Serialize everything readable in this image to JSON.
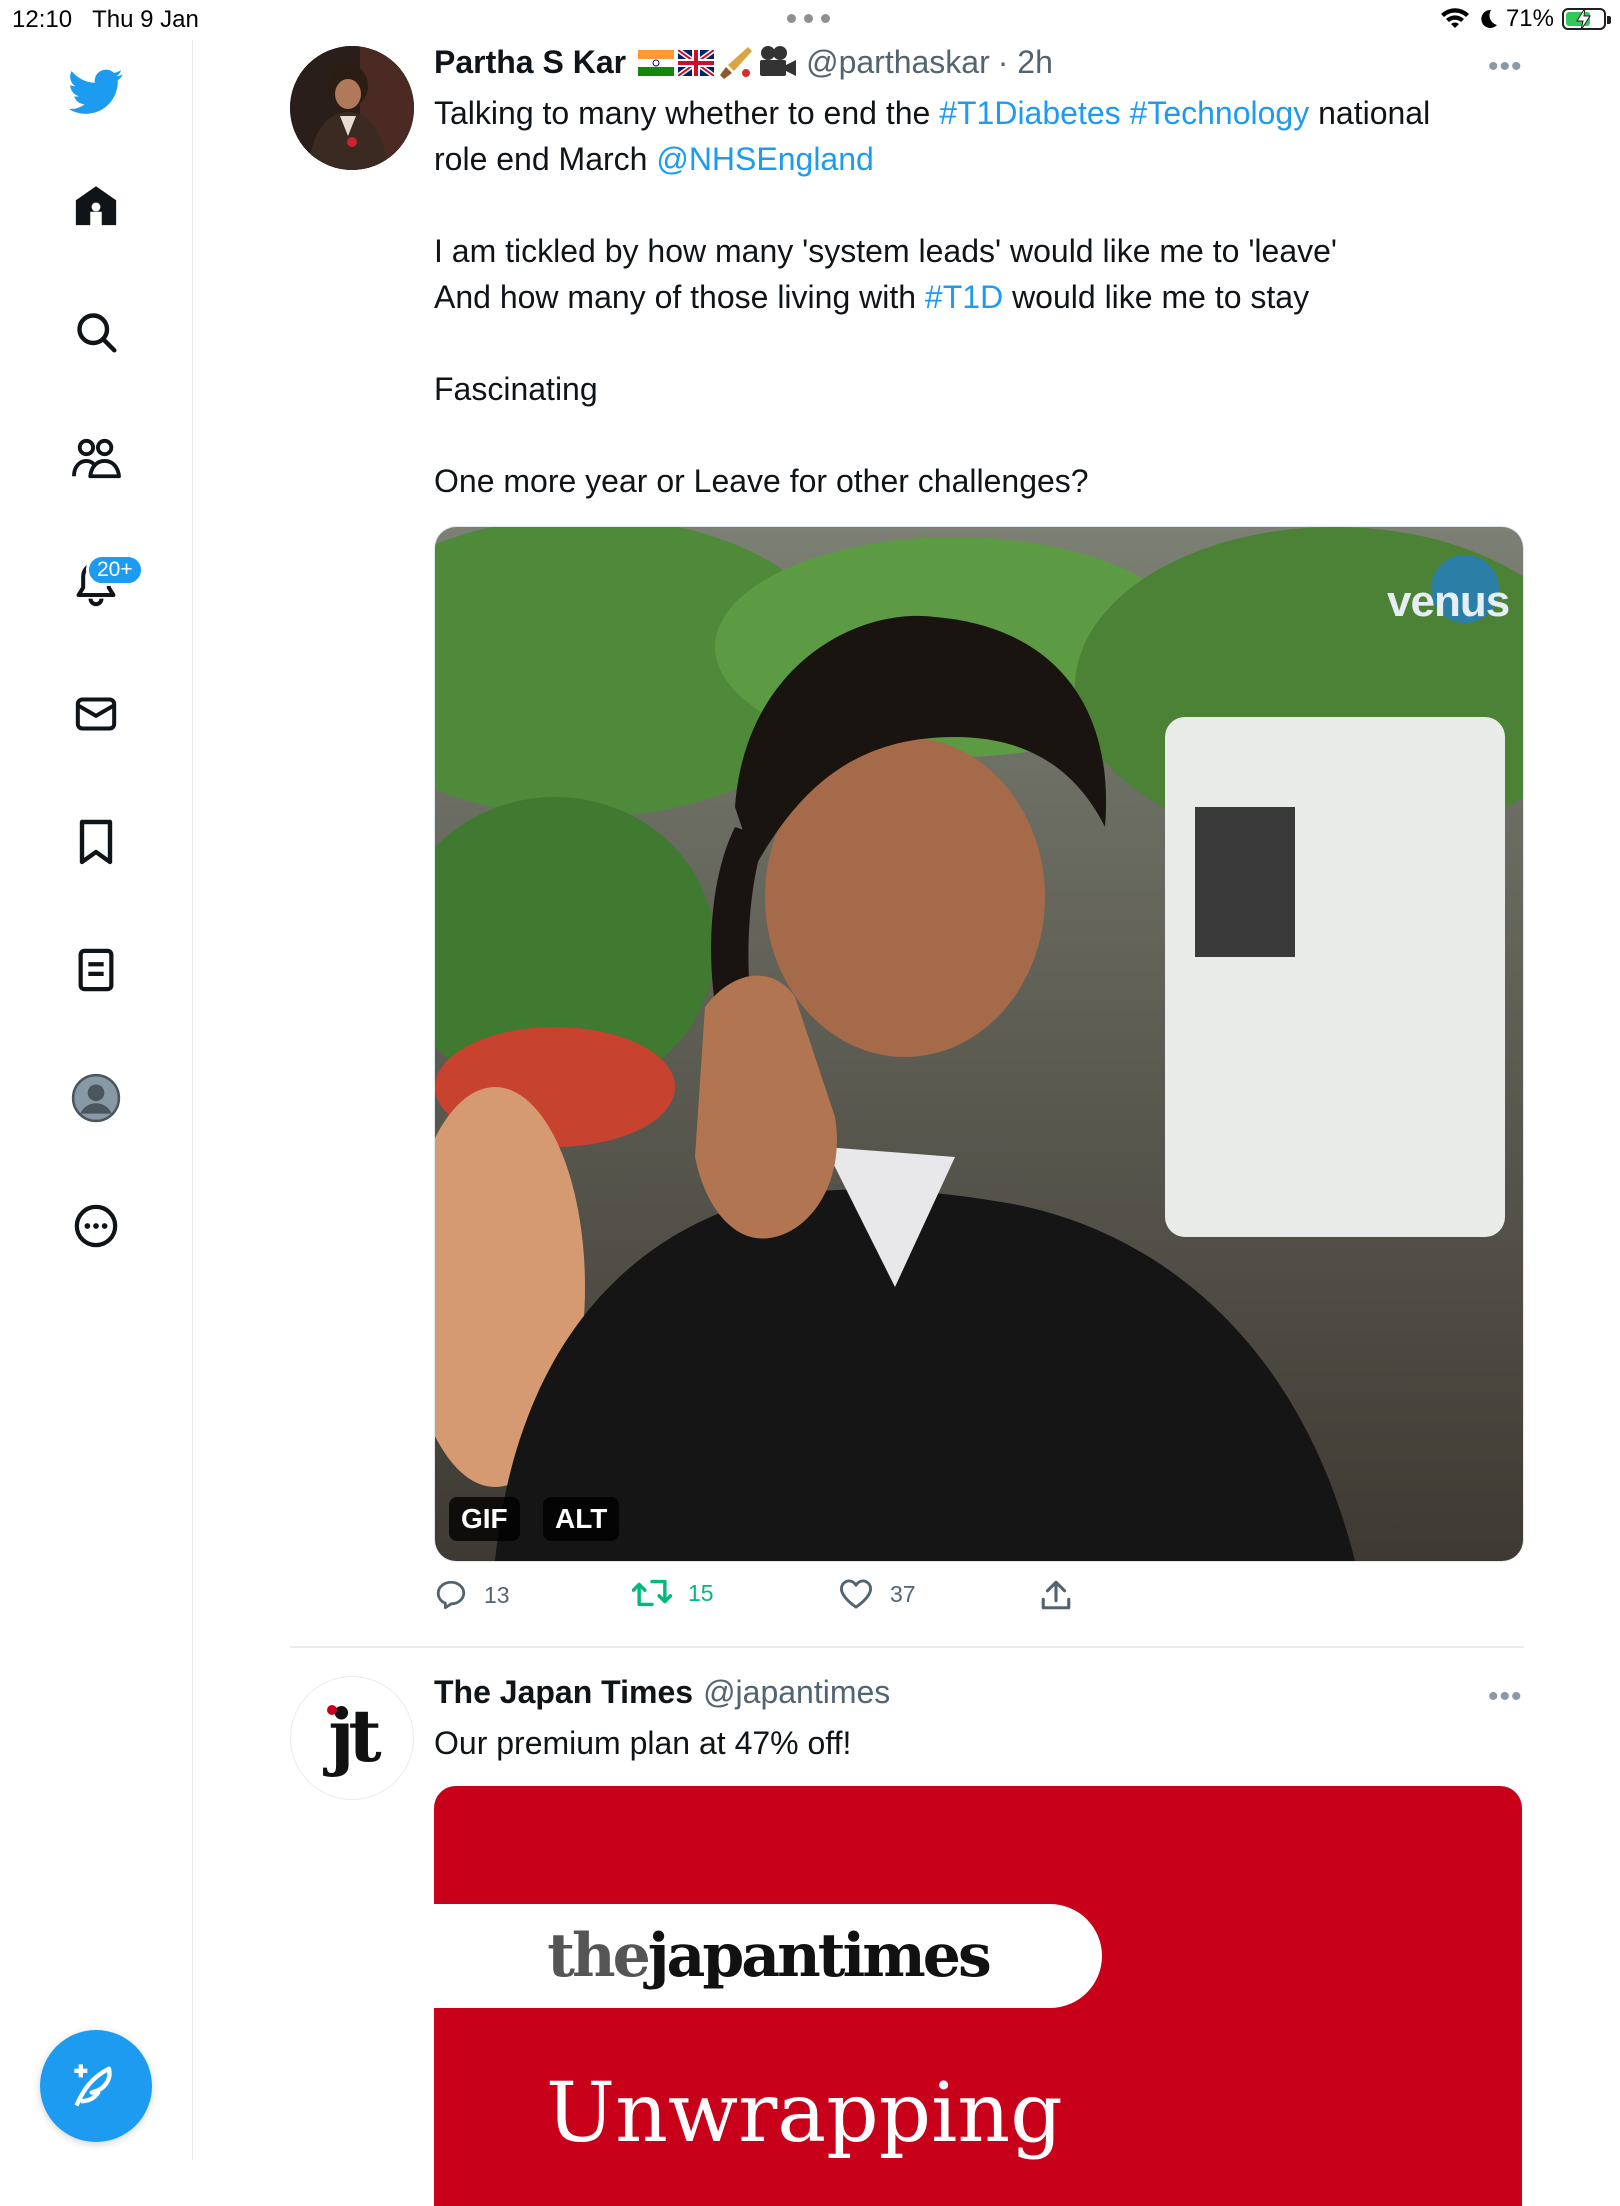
{
  "status_bar": {
    "time": "12:10",
    "date": "Thu 9 Jan",
    "battery": "71%",
    "battery_level": 0.71
  },
  "sidebar": {
    "items": [
      {
        "name": "home",
        "icon": "home-icon"
      },
      {
        "name": "explore",
        "icon": "search-icon"
      },
      {
        "name": "communities",
        "icon": "people-icon"
      },
      {
        "name": "notifications",
        "icon": "bell-icon",
        "badge": "20+"
      },
      {
        "name": "messages",
        "icon": "envelope-icon"
      },
      {
        "name": "bookmarks",
        "icon": "bookmark-icon"
      },
      {
        "name": "lists",
        "icon": "list-icon"
      },
      {
        "name": "profile",
        "icon": "profile-icon"
      },
      {
        "name": "more",
        "icon": "more-circle-icon"
      }
    ],
    "compose_icon": "compose-feather-icon"
  },
  "tweets": [
    {
      "name": "Partha S Kar",
      "handle": "@parthaskar",
      "time": "· 2h",
      "more": "•••",
      "text": {
        "l1_a": "Talking to many whether to end the ",
        "l1_tag1": "#T1Diabetes",
        "l1_tag2": "#Technology",
        "l1_b": " national",
        "l2_a": "role end March ",
        "l2_mention": "@NHSEngland",
        "l3": "I am tickled by how many 'system leads' would like me to 'leave'",
        "l4_a": "And how many of those living with ",
        "l4_tag": "#T1D",
        "l4_b": " would like me to stay",
        "l5": "Fascinating",
        "l6": "One more year or Leave for other challenges?"
      },
      "media": {
        "watermark": "venus",
        "gif_label": "GIF",
        "alt_label": "ALT"
      },
      "actions": {
        "replies": "13",
        "retweets": "15",
        "likes": "37"
      }
    },
    {
      "name": "The Japan Times",
      "handle": "@japantimes",
      "more": "•••",
      "avatar_text": "jt",
      "text": "Our premium plan at 47% off!",
      "ad": {
        "logo_a": "the",
        "logo_b": "japantimes",
        "headline": "Unwrapping"
      }
    }
  ],
  "colors": {
    "accent": "#1d9bf0",
    "retweet": "#00ba7c",
    "ad_red": "#c8001a"
  }
}
